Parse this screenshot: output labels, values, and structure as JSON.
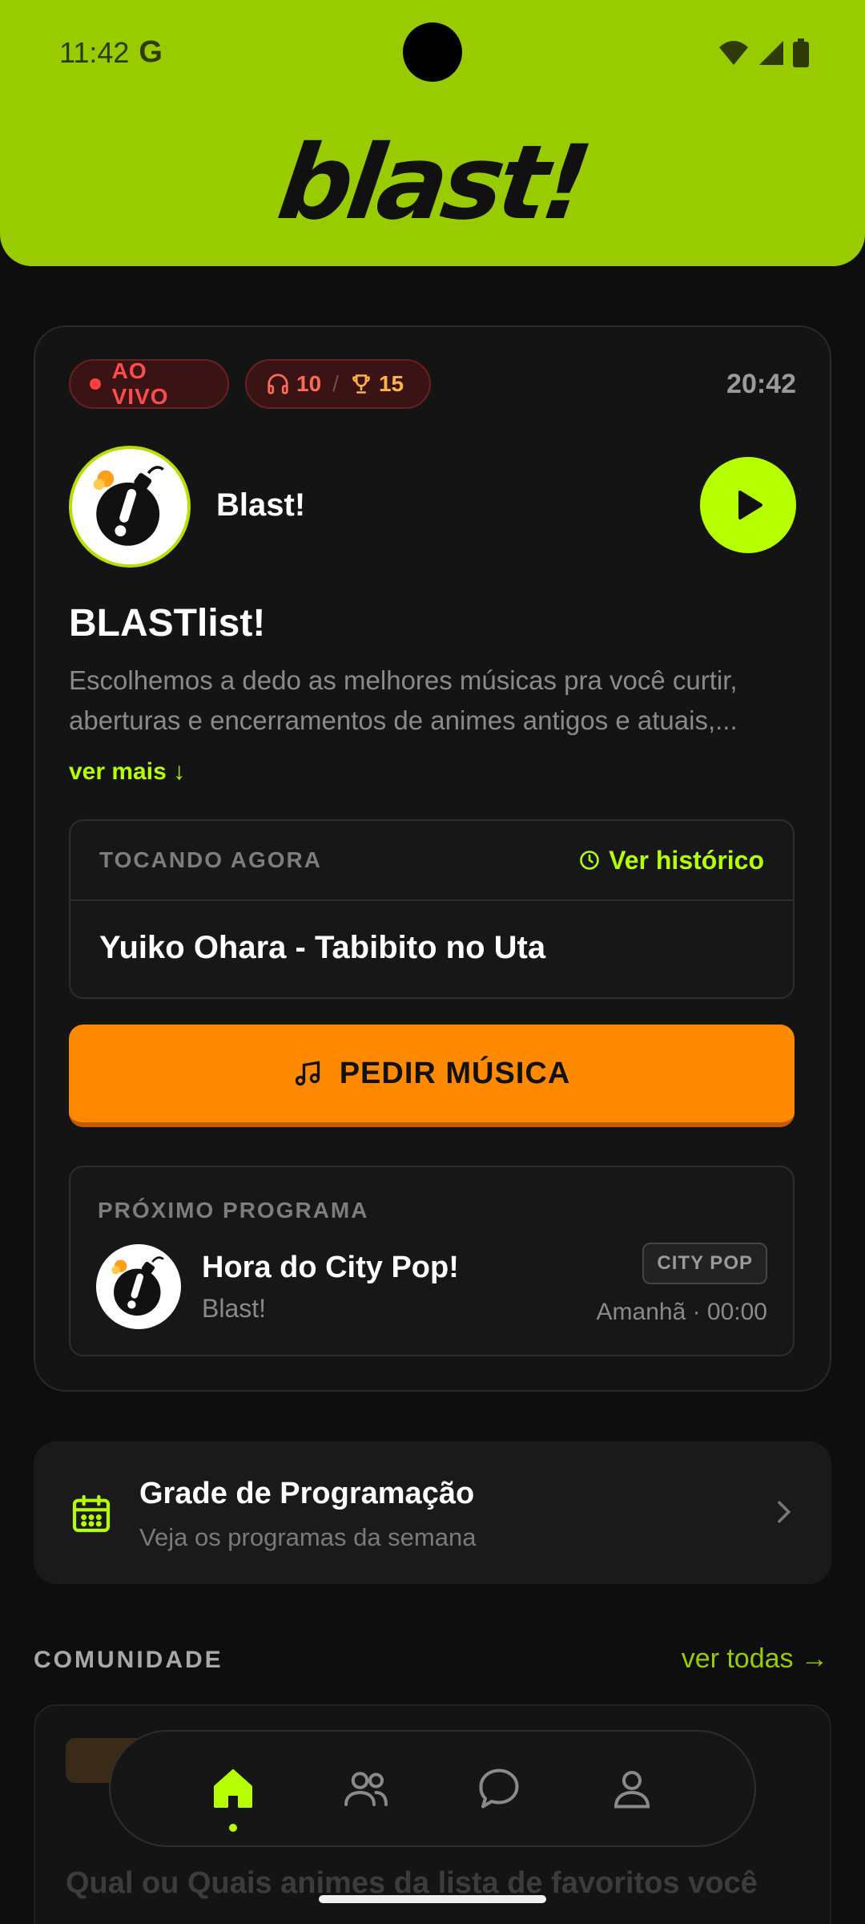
{
  "status_bar": {
    "time": "11:42",
    "g_badge": "G"
  },
  "header": {
    "logo": "blast!",
    "accent": "#99cc00"
  },
  "live_card": {
    "live_label": "AO VIVO",
    "listeners": "10",
    "separator": "/",
    "trophies": "15",
    "clock": "20:42",
    "station_name": "Blast!",
    "show_title": "BLASTlist!",
    "show_description": "Escolhemos a dedo as melhores músicas pra você curtir, aberturas e encerramentos de animes antigos e atuais,...",
    "ver_mais": "ver mais ↓",
    "now_playing_label": "TOCANDO AGORA",
    "history_link": "Ver histórico",
    "now_playing_song": "Yuiko Ohara - Tabibito no Uta",
    "request_button": "PEDIR MÚSICA",
    "next_label": "PRÓXIMO PROGRAMA",
    "next_title": "Hora do City Pop!",
    "next_station": "Blast!",
    "next_genre": "CITY POP",
    "next_time": "Amanhã · 00:00"
  },
  "schedule": {
    "title": "Grade de Programação",
    "subtitle": "Veja os programas da semana"
  },
  "community": {
    "section_label": "COMUNIDADE",
    "see_all": "ver todas →",
    "post_preview": "Qual ou Quais animes da lista de favoritos você"
  },
  "bottom_nav": {
    "items": [
      "home-icon",
      "users-icon",
      "chat-icon",
      "profile-icon"
    ],
    "active": "home"
  },
  "colors": {
    "primary": "#b5ff00",
    "orange": "#ff8a00",
    "live_red": "#ff4d4d",
    "background": "#0e0e0e"
  }
}
